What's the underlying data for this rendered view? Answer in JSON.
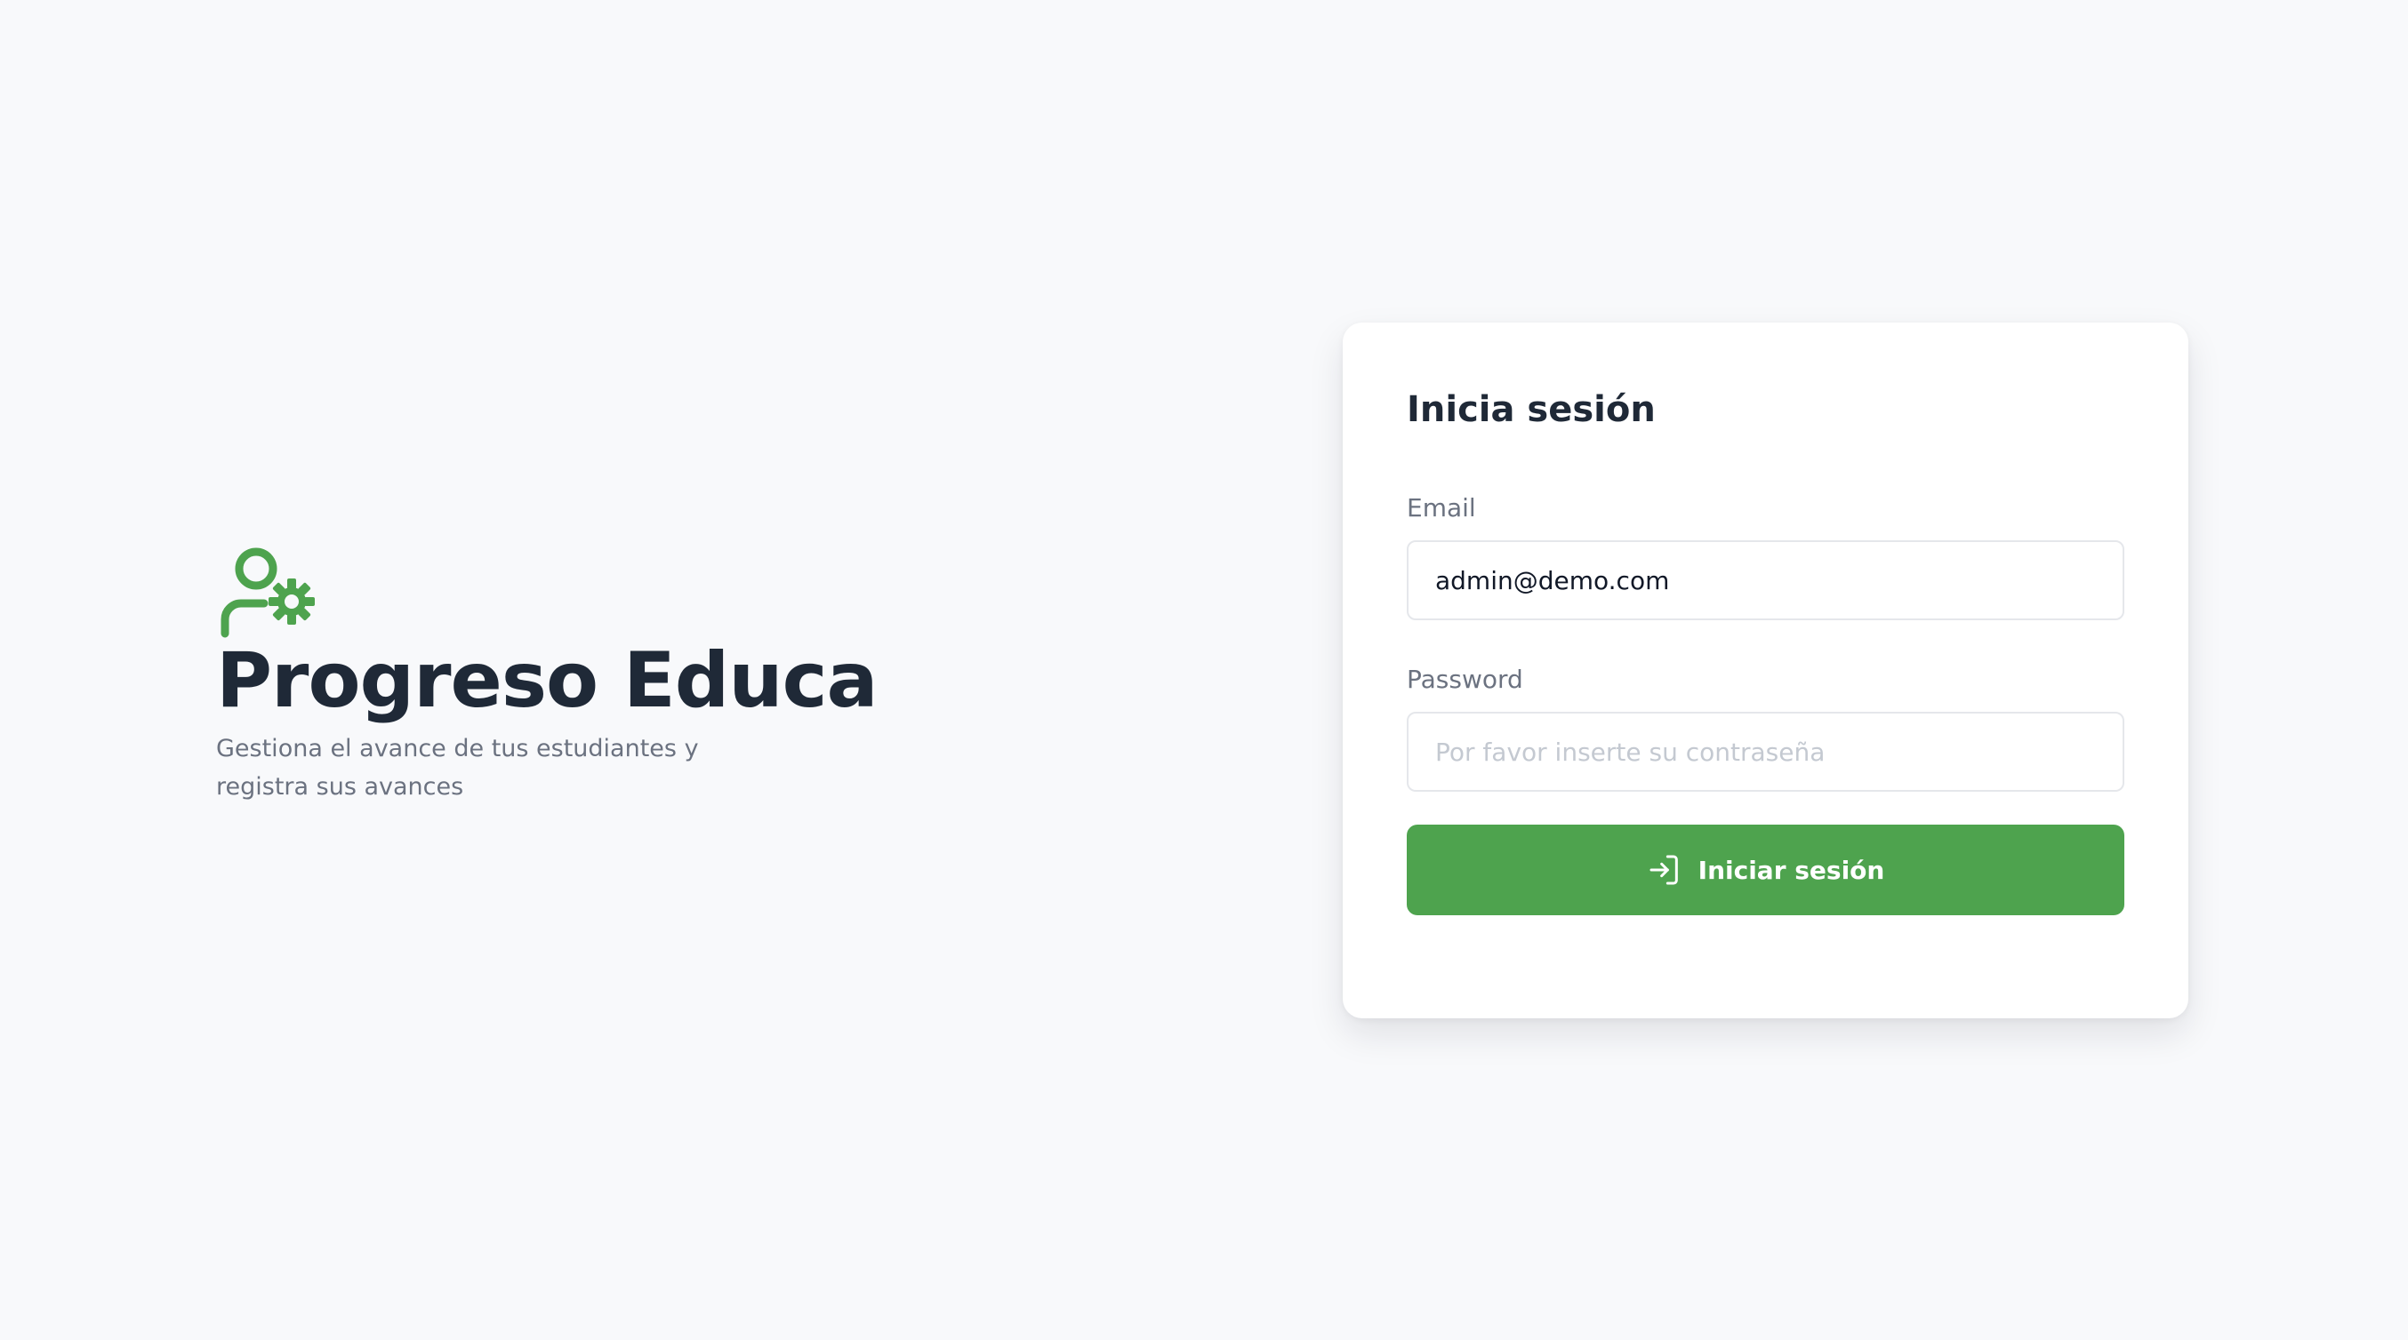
{
  "brand": {
    "icon": "user-settings-icon",
    "title": "Progreso Educa",
    "subtitle": "Gestiona el avance de tus estudiantes y registra sus avances"
  },
  "login": {
    "title": "Inicia sesión",
    "email_label": "Email",
    "email_value": "admin@demo.com",
    "password_label": "Password",
    "password_placeholder": "Por favor inserte su contraseña",
    "password_value": "",
    "submit_label": "Iniciar sesión",
    "submit_icon": "login-icon"
  },
  "colors": {
    "accent": "#4ea34e",
    "background": "#f8f9fb",
    "title_text": "#1f2937",
    "muted_text": "#6b7280"
  }
}
